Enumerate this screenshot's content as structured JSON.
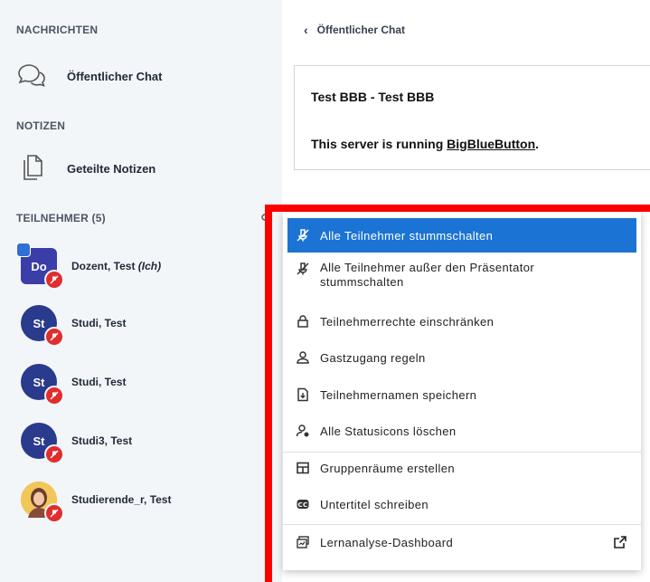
{
  "sidebar": {
    "messages_title": "NACHRICHTEN",
    "public_chat": "Öffentlicher Chat",
    "notes_title": "NOTIZEN",
    "shared_notes": "Geteilte Notizen",
    "participants_title": "TEILNEHMER (5)",
    "users": [
      {
        "initials": "Do",
        "name": "Dozent, Test",
        "you": "(Ich)"
      },
      {
        "initials": "St",
        "name": "Studi, Test"
      },
      {
        "initials": "St",
        "name": "Studi, Test"
      },
      {
        "initials": "St",
        "name": "Studi3, Test"
      },
      {
        "initials": "",
        "name": "Studierende_r, Test"
      }
    ]
  },
  "chat": {
    "back_label": "Öffentlicher Chat",
    "welcome_line1": "Test BBB - Test BBB",
    "welcome_line2_prefix": "This server is running ",
    "welcome_link": "BigBlueButton",
    "welcome_line2_suffix": "."
  },
  "menu": {
    "items": [
      {
        "label": "Alle Teilnehmer stummschalten",
        "icon": "mic-off-icon",
        "active": true
      },
      {
        "label": "Alle Teilnehmer außer den Präsentator stummschalten",
        "icon": "mic-off-icon"
      },
      {
        "label": "Teilnehmerrechte einschränken",
        "icon": "lock-icon"
      },
      {
        "label": "Gastzugang regeln",
        "icon": "user-icon"
      },
      {
        "label": "Teilnehmernamen speichern",
        "icon": "download-icon"
      },
      {
        "label": "Alle Statusicons löschen",
        "icon": "clear-status-icon"
      },
      {
        "label": "Gruppenräume erstellen",
        "icon": "rooms-icon"
      },
      {
        "label": "Untertitel schreiben",
        "icon": "cc-icon"
      },
      {
        "label": "Lernanalyse-Dashboard",
        "icon": "dashboard-icon"
      }
    ]
  },
  "colors": {
    "accent": "#1b73d3",
    "mute_red": "#e02d2d",
    "avatar_blue": "#2a3a8c",
    "highlight_frame": "#ff0000"
  }
}
